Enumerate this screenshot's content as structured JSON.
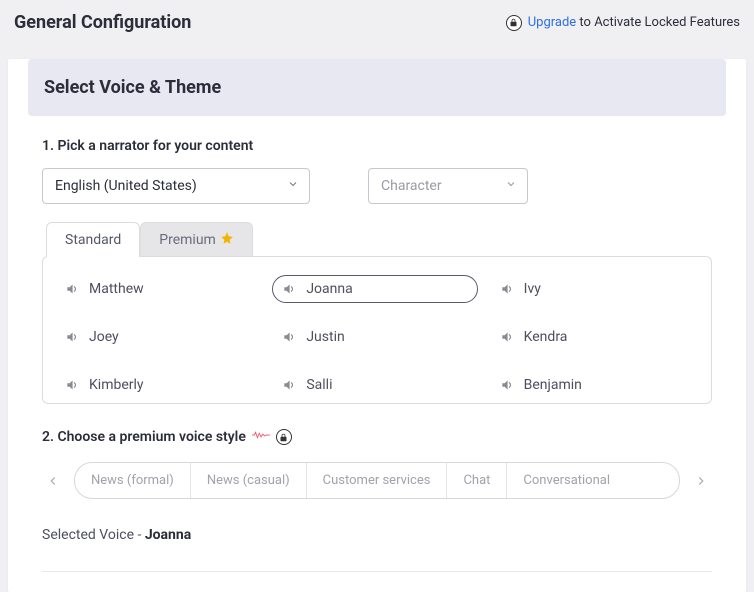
{
  "header": {
    "title": "General Configuration",
    "upgrade_link": "Upgrade",
    "upgrade_rest": " to Activate Locked Features"
  },
  "section": {
    "title": "Select Voice & Theme"
  },
  "step1": {
    "label": "1. Pick a narrator for your content",
    "language_value": "English (United States)",
    "character_placeholder": "Character"
  },
  "tabs": {
    "standard": "Standard",
    "premium": "Premium"
  },
  "voices": [
    "Matthew",
    "Joanna",
    "Ivy",
    "Joey",
    "Justin",
    "Kendra",
    "Kimberly",
    "Salli",
    "Benjamin"
  ],
  "selected_voice_index": 1,
  "step2": {
    "label": "2. Choose a premium voice style"
  },
  "styles": [
    "News (formal)",
    "News (casual)",
    "Customer services",
    "Chat",
    "Conversational"
  ],
  "selected_line": {
    "prefix": "Selected Voice - ",
    "name": "Joanna"
  }
}
